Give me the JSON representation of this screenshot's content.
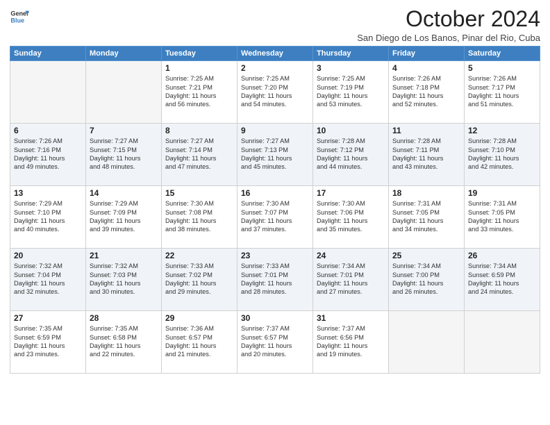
{
  "logo": {
    "line1": "General",
    "line2": "Blue"
  },
  "title": "October 2024",
  "location": "San Diego de Los Banos, Pinar del Rio, Cuba",
  "headers": [
    "Sunday",
    "Monday",
    "Tuesday",
    "Wednesday",
    "Thursday",
    "Friday",
    "Saturday"
  ],
  "weeks": [
    [
      {
        "day": "",
        "sunrise": "",
        "sunset": "",
        "daylight": "",
        "empty": true
      },
      {
        "day": "",
        "sunrise": "",
        "sunset": "",
        "daylight": "",
        "empty": true
      },
      {
        "day": "1",
        "sunrise": "Sunrise: 7:25 AM",
        "sunset": "Sunset: 7:21 PM",
        "daylight": "Daylight: 11 hours and 56 minutes."
      },
      {
        "day": "2",
        "sunrise": "Sunrise: 7:25 AM",
        "sunset": "Sunset: 7:20 PM",
        "daylight": "Daylight: 11 hours and 54 minutes."
      },
      {
        "day": "3",
        "sunrise": "Sunrise: 7:25 AM",
        "sunset": "Sunset: 7:19 PM",
        "daylight": "Daylight: 11 hours and 53 minutes."
      },
      {
        "day": "4",
        "sunrise": "Sunrise: 7:26 AM",
        "sunset": "Sunset: 7:18 PM",
        "daylight": "Daylight: 11 hours and 52 minutes."
      },
      {
        "day": "5",
        "sunrise": "Sunrise: 7:26 AM",
        "sunset": "Sunset: 7:17 PM",
        "daylight": "Daylight: 11 hours and 51 minutes."
      }
    ],
    [
      {
        "day": "6",
        "sunrise": "Sunrise: 7:26 AM",
        "sunset": "Sunset: 7:16 PM",
        "daylight": "Daylight: 11 hours and 49 minutes."
      },
      {
        "day": "7",
        "sunrise": "Sunrise: 7:27 AM",
        "sunset": "Sunset: 7:15 PM",
        "daylight": "Daylight: 11 hours and 48 minutes."
      },
      {
        "day": "8",
        "sunrise": "Sunrise: 7:27 AM",
        "sunset": "Sunset: 7:14 PM",
        "daylight": "Daylight: 11 hours and 47 minutes."
      },
      {
        "day": "9",
        "sunrise": "Sunrise: 7:27 AM",
        "sunset": "Sunset: 7:13 PM",
        "daylight": "Daylight: 11 hours and 45 minutes."
      },
      {
        "day": "10",
        "sunrise": "Sunrise: 7:28 AM",
        "sunset": "Sunset: 7:12 PM",
        "daylight": "Daylight: 11 hours and 44 minutes."
      },
      {
        "day": "11",
        "sunrise": "Sunrise: 7:28 AM",
        "sunset": "Sunset: 7:11 PM",
        "daylight": "Daylight: 11 hours and 43 minutes."
      },
      {
        "day": "12",
        "sunrise": "Sunrise: 7:28 AM",
        "sunset": "Sunset: 7:10 PM",
        "daylight": "Daylight: 11 hours and 42 minutes."
      }
    ],
    [
      {
        "day": "13",
        "sunrise": "Sunrise: 7:29 AM",
        "sunset": "Sunset: 7:10 PM",
        "daylight": "Daylight: 11 hours and 40 minutes."
      },
      {
        "day": "14",
        "sunrise": "Sunrise: 7:29 AM",
        "sunset": "Sunset: 7:09 PM",
        "daylight": "Daylight: 11 hours and 39 minutes."
      },
      {
        "day": "15",
        "sunrise": "Sunrise: 7:30 AM",
        "sunset": "Sunset: 7:08 PM",
        "daylight": "Daylight: 11 hours and 38 minutes."
      },
      {
        "day": "16",
        "sunrise": "Sunrise: 7:30 AM",
        "sunset": "Sunset: 7:07 PM",
        "daylight": "Daylight: 11 hours and 37 minutes."
      },
      {
        "day": "17",
        "sunrise": "Sunrise: 7:30 AM",
        "sunset": "Sunset: 7:06 PM",
        "daylight": "Daylight: 11 hours and 35 minutes."
      },
      {
        "day": "18",
        "sunrise": "Sunrise: 7:31 AM",
        "sunset": "Sunset: 7:05 PM",
        "daylight": "Daylight: 11 hours and 34 minutes."
      },
      {
        "day": "19",
        "sunrise": "Sunrise: 7:31 AM",
        "sunset": "Sunset: 7:05 PM",
        "daylight": "Daylight: 11 hours and 33 minutes."
      }
    ],
    [
      {
        "day": "20",
        "sunrise": "Sunrise: 7:32 AM",
        "sunset": "Sunset: 7:04 PM",
        "daylight": "Daylight: 11 hours and 32 minutes."
      },
      {
        "day": "21",
        "sunrise": "Sunrise: 7:32 AM",
        "sunset": "Sunset: 7:03 PM",
        "daylight": "Daylight: 11 hours and 30 minutes."
      },
      {
        "day": "22",
        "sunrise": "Sunrise: 7:33 AM",
        "sunset": "Sunset: 7:02 PM",
        "daylight": "Daylight: 11 hours and 29 minutes."
      },
      {
        "day": "23",
        "sunrise": "Sunrise: 7:33 AM",
        "sunset": "Sunset: 7:01 PM",
        "daylight": "Daylight: 11 hours and 28 minutes."
      },
      {
        "day": "24",
        "sunrise": "Sunrise: 7:34 AM",
        "sunset": "Sunset: 7:01 PM",
        "daylight": "Daylight: 11 hours and 27 minutes."
      },
      {
        "day": "25",
        "sunrise": "Sunrise: 7:34 AM",
        "sunset": "Sunset: 7:00 PM",
        "daylight": "Daylight: 11 hours and 26 minutes."
      },
      {
        "day": "26",
        "sunrise": "Sunrise: 7:34 AM",
        "sunset": "Sunset: 6:59 PM",
        "daylight": "Daylight: 11 hours and 24 minutes."
      }
    ],
    [
      {
        "day": "27",
        "sunrise": "Sunrise: 7:35 AM",
        "sunset": "Sunset: 6:59 PM",
        "daylight": "Daylight: 11 hours and 23 minutes."
      },
      {
        "day": "28",
        "sunrise": "Sunrise: 7:35 AM",
        "sunset": "Sunset: 6:58 PM",
        "daylight": "Daylight: 11 hours and 22 minutes."
      },
      {
        "day": "29",
        "sunrise": "Sunrise: 7:36 AM",
        "sunset": "Sunset: 6:57 PM",
        "daylight": "Daylight: 11 hours and 21 minutes."
      },
      {
        "day": "30",
        "sunrise": "Sunrise: 7:37 AM",
        "sunset": "Sunset: 6:57 PM",
        "daylight": "Daylight: 11 hours and 20 minutes."
      },
      {
        "day": "31",
        "sunrise": "Sunrise: 7:37 AM",
        "sunset": "Sunset: 6:56 PM",
        "daylight": "Daylight: 11 hours and 19 minutes."
      },
      {
        "day": "",
        "sunrise": "",
        "sunset": "",
        "daylight": "",
        "empty": true
      },
      {
        "day": "",
        "sunrise": "",
        "sunset": "",
        "daylight": "",
        "empty": true
      }
    ]
  ]
}
